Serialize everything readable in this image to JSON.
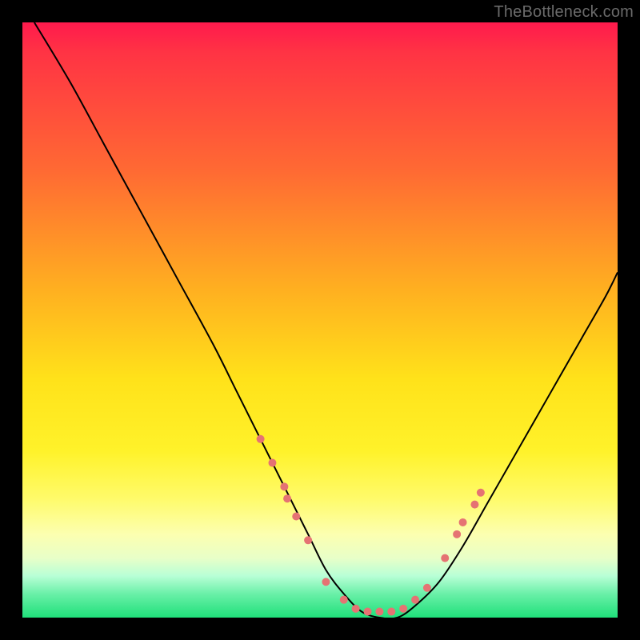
{
  "watermark": {
    "text": "TheBottleneck.com"
  },
  "chart_data": {
    "type": "line",
    "title": "",
    "xlabel": "",
    "ylabel": "",
    "xlim": [
      0,
      100
    ],
    "ylim": [
      0,
      100
    ],
    "grid": false,
    "legend": false,
    "background_gradient": {
      "stops": [
        {
          "pos": 0.0,
          "hex": "#ff1a4d"
        },
        {
          "pos": 0.05,
          "hex": "#ff3344"
        },
        {
          "pos": 0.25,
          "hex": "#ff6a33"
        },
        {
          "pos": 0.45,
          "hex": "#ffb020"
        },
        {
          "pos": 0.6,
          "hex": "#ffe21a"
        },
        {
          "pos": 0.72,
          "hex": "#fff22a"
        },
        {
          "pos": 0.8,
          "hex": "#fffb6a"
        },
        {
          "pos": 0.86,
          "hex": "#fcffb0"
        },
        {
          "pos": 0.9,
          "hex": "#e8ffc8"
        },
        {
          "pos": 0.93,
          "hex": "#b8ffd6"
        },
        {
          "pos": 0.96,
          "hex": "#6af0a8"
        },
        {
          "pos": 1.0,
          "hex": "#1fe07a"
        }
      ]
    },
    "series": [
      {
        "name": "bottleneck-curve",
        "color": "#000000",
        "stroke_width": 2,
        "x": [
          2,
          8,
          14,
          20,
          26,
          32,
          36,
          40,
          44,
          48,
          51,
          54,
          57,
          60,
          63,
          66,
          70,
          74,
          78,
          82,
          86,
          90,
          94,
          98,
          100
        ],
        "y": [
          100,
          90,
          79,
          68,
          57,
          46,
          38,
          30,
          22,
          14,
          8,
          4,
          1,
          0,
          0,
          2,
          6,
          12,
          19,
          26,
          33,
          40,
          47,
          54,
          58
        ]
      }
    ],
    "markers": [
      {
        "name": "left-cluster",
        "color": "#e57373",
        "radius": 5,
        "points": [
          {
            "x": 40,
            "y": 30
          },
          {
            "x": 42,
            "y": 26
          },
          {
            "x": 44,
            "y": 22
          },
          {
            "x": 44.5,
            "y": 20
          },
          {
            "x": 46,
            "y": 17
          },
          {
            "x": 48,
            "y": 13
          }
        ]
      },
      {
        "name": "bottom-cluster",
        "color": "#e57373",
        "radius": 5,
        "points": [
          {
            "x": 51,
            "y": 6
          },
          {
            "x": 54,
            "y": 3
          },
          {
            "x": 56,
            "y": 1.5
          },
          {
            "x": 58,
            "y": 1
          },
          {
            "x": 60,
            "y": 1
          },
          {
            "x": 62,
            "y": 1
          },
          {
            "x": 64,
            "y": 1.5
          },
          {
            "x": 66,
            "y": 3
          },
          {
            "x": 68,
            "y": 5
          }
        ]
      },
      {
        "name": "right-cluster",
        "color": "#e57373",
        "radius": 5,
        "points": [
          {
            "x": 71,
            "y": 10
          },
          {
            "x": 73,
            "y": 14
          },
          {
            "x": 74,
            "y": 16
          },
          {
            "x": 76,
            "y": 19
          },
          {
            "x": 77,
            "y": 21
          }
        ]
      }
    ]
  }
}
